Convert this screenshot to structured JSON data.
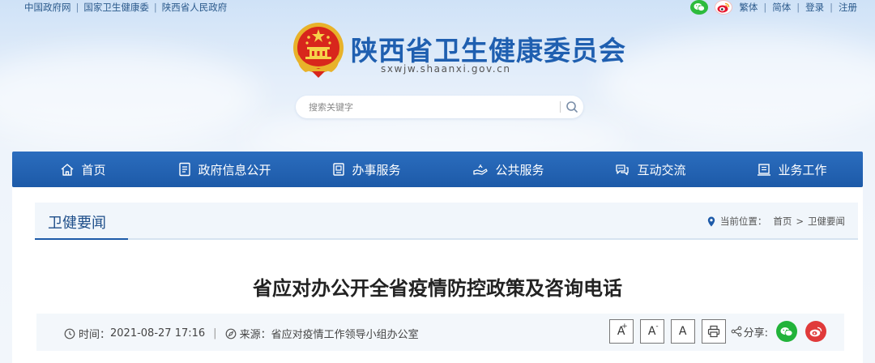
{
  "topbar": {
    "links": [
      "中国政府网",
      "国家卫生健康委",
      "陕西省人民政府"
    ],
    "separator": "|",
    "right_links": [
      "繁体",
      "简体",
      "登录",
      "注册"
    ]
  },
  "header": {
    "title": "陕西省卫生健康委员会",
    "domain": "sxwjw.shaanxi.gov.cn"
  },
  "search": {
    "placeholder": "搜索关键字"
  },
  "nav": {
    "items": [
      {
        "label": "首页",
        "icon": "home-icon"
      },
      {
        "label": "政府信息公开",
        "icon": "document-list-icon"
      },
      {
        "label": "办事服务",
        "icon": "service-icon"
      },
      {
        "label": "公共服务",
        "icon": "public-service-icon"
      },
      {
        "label": "互动交流",
        "icon": "chat-icon"
      },
      {
        "label": "业务工作",
        "icon": "business-icon"
      }
    ]
  },
  "breadcrumb": {
    "section_title": "卫健要闻",
    "location_label": "当前位置：",
    "home": "首页",
    "arrow": ">",
    "current": "卫健要闻"
  },
  "article": {
    "title": "省应对办公开全省疫情防控政策及咨询电话",
    "time_label": "时间：",
    "time": "2021-08-27 17:16",
    "separator": "|",
    "source_label": "来源：",
    "source": "省应对疫情工作领导小组办公室",
    "font_large": "A",
    "font_large_sup": "+",
    "font_small": "A",
    "font_small_sup": "-",
    "font_default": "A",
    "share_label": "分享:"
  },
  "colors": {
    "nav_bg": "#1d5aa8",
    "title_blue": "#1f5fb0",
    "wechat_green": "#22b33a",
    "weibo_red": "#e03a3a"
  }
}
